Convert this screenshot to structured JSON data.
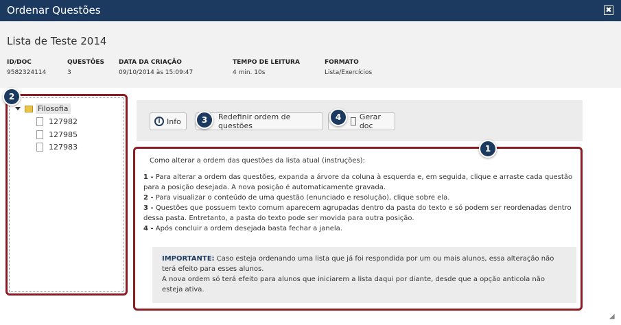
{
  "window": {
    "title": "Ordenar Questões",
    "close_glyph": "✖"
  },
  "list": {
    "name": "Lista de Teste 2014",
    "meta": [
      {
        "label": "ID/DOC",
        "value": "9582324114"
      },
      {
        "label": "QUESTÕES",
        "value": "3"
      },
      {
        "label": "DATA DA CRIAÇÃO",
        "value": "09/10/2014 às 15:09:47"
      },
      {
        "label": "TEMPO DE LEITURA",
        "value": "4 min. 10s"
      },
      {
        "label": "FORMATO",
        "value": "Lista/Exercícios"
      }
    ]
  },
  "tree": {
    "folder": "Filosofia",
    "files": [
      "127982",
      "127985",
      "127983"
    ]
  },
  "toolbar": {
    "info_label": "Info",
    "reset_label": "Redefinir ordem de questões",
    "generate_label": "Gerar doc"
  },
  "instructions": {
    "heading": "Como alterar a ordem das questões da lista atual (instruções):",
    "steps": [
      {
        "num": "1 -",
        "text": "Para alterar a ordem das questões, expanda a árvore da coluna à esquerda e, em seguida, clique e arraste cada questão para a posição desejada. A nova posição é automaticamente gravada."
      },
      {
        "num": "2 -",
        "text": "Para visualizar o conteúdo de uma questão (enunciado e resolução), clique sobre ela."
      },
      {
        "num": "3 -",
        "text": "Questões que possuem texto comum aparecem agrupadas dentro da pasta do texto e só podem ser reordenadas dentro dessa pasta. Entretanto, a pasta do texto pode ser movida para outra posição."
      },
      {
        "num": "4 -",
        "text": "Após concluir a ordem desejada basta fechar a janela."
      }
    ],
    "important_label": "IMPORTANTE:",
    "important_text": "Caso esteja ordenando uma lista que já foi respondida por um ou mais alunos, essa alteração não terá efeito para esses alunos.",
    "important_text2": "A nova ordem só terá efeito para alunos que iniciarem a lista daqui por diante, desde que a opção anticola não esteja ativa."
  },
  "badges": [
    "1",
    "2",
    "3",
    "4"
  ],
  "colors": {
    "titlebar": "#1c3a5f",
    "highlight": "#8b1a22",
    "panel": "#f2f2f2"
  }
}
